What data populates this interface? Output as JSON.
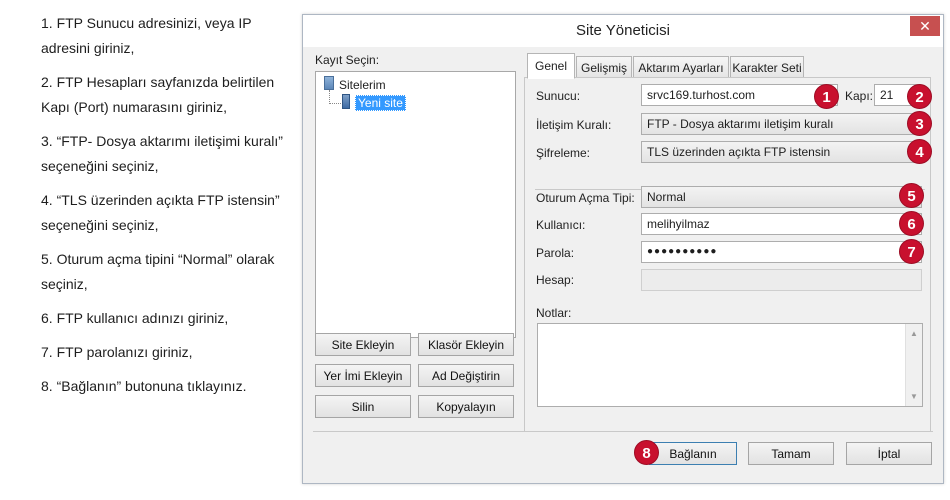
{
  "instructions": [
    "1. FTP Sunucu adresinizi, veya IP adresini giriniz,",
    "2. FTP Hesapları sayfanızda belirtilen Kapı (Port) numarasını giriniz,",
    "3. “FTP- Dosya aktarımı iletişimi kuralı” seçeneğini seçiniz,",
    "4. “TLS üzerinden açıkta FTP istensin” seçeneğini seçiniz,",
    "5. Oturum açma tipini “Normal” olarak seçiniz,",
    "6. FTP kullanıcı adınızı giriniz,",
    "7. FTP parolanızı giriniz,",
    "8. “Bağlanın” butonuna tıklayınız."
  ],
  "window": {
    "title": "Site Yöneticisi",
    "close_glyph": "✕"
  },
  "tree": {
    "label": "Kayıt Seçin:",
    "root": "Sitelerim",
    "item": "Yeni site",
    "root_icon": "folder-icon",
    "item_icon": "server-icon"
  },
  "left_buttons": {
    "add_site": "Site Ekleyin",
    "add_folder": "Klasör Ekleyin",
    "add_bookmark": "Yer İmi Ekleyin",
    "rename": "Ad Değiştirin",
    "delete": "Silin",
    "copy": "Kopyalayın"
  },
  "tabs": [
    "Genel",
    "Gelişmiş",
    "Aktarım Ayarları",
    "Karakter Seti"
  ],
  "form": {
    "host_label": "Sunucu:",
    "host_value": "srvc169.turhost.com",
    "port_label": "Kapı:",
    "port_value": "21",
    "protocol_label": "İletişim Kuralı:",
    "protocol_value": "FTP - Dosya aktarımı iletişim kuralı",
    "encryption_label": "Şifreleme:",
    "encryption_value": "TLS üzerinden açıkta FTP istensin",
    "logon_label": "Oturum Açma Tipi:",
    "logon_value": "Normal",
    "user_label": "Kullanıcı:",
    "user_value": "melihyilmaz",
    "password_label": "Parola:",
    "password_value": "●●●●●●●●●●",
    "account_label": "Hesap:",
    "account_value": "",
    "notes_label": "Notlar:"
  },
  "bottom_buttons": {
    "connect": "Bağlanın",
    "ok": "Tamam",
    "cancel": "İptal"
  },
  "badges": [
    "1",
    "2",
    "3",
    "4",
    "5",
    "6",
    "7",
    "8"
  ],
  "colors": {
    "badge": "#c8102e",
    "selection": "#3399ff",
    "close": "#c75050"
  }
}
